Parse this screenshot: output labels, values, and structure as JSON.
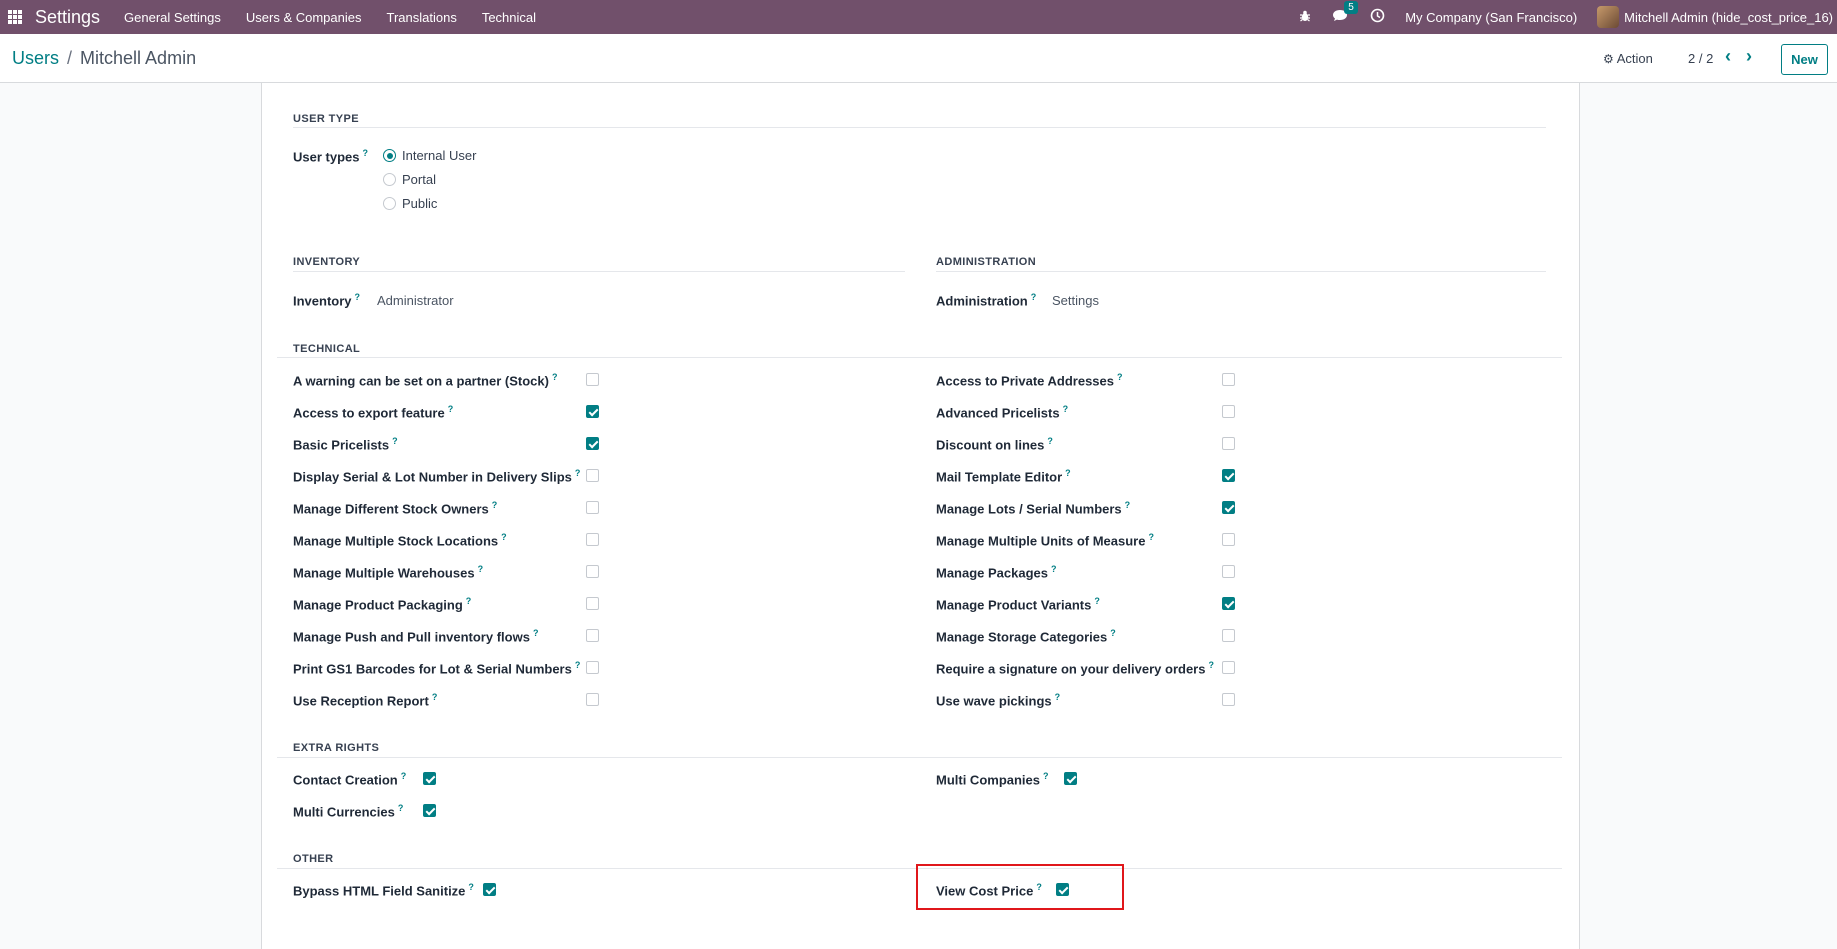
{
  "navbar": {
    "brand": "Settings",
    "menu": [
      "General Settings",
      "Users & Companies",
      "Translations",
      "Technical"
    ],
    "chat_count": "5",
    "company": "My Company (San Francisco)",
    "user": "Mitchell Admin (hide_cost_price_16)"
  },
  "control": {
    "breadcrumb_parent": "Users",
    "breadcrumb_sep": "/",
    "breadcrumb_current": "Mitchell Admin",
    "action": "Action",
    "pager": "2 / 2",
    "new": "New"
  },
  "user_type": {
    "title": "USER TYPE",
    "label": "User types",
    "options": [
      "Internal User",
      "Portal",
      "Public"
    ],
    "selected": "Internal User"
  },
  "inventory": {
    "title": "INVENTORY",
    "label": "Inventory",
    "value": "Administrator"
  },
  "administration": {
    "title": "ADMINISTRATION",
    "label": "Administration",
    "value": "Settings"
  },
  "technical": {
    "title": "TECHNICAL",
    "left": [
      {
        "label": "A warning can be set on a partner (Stock)",
        "checked": false
      },
      {
        "label": "Access to export feature",
        "checked": true
      },
      {
        "label": "Basic Pricelists",
        "checked": true
      },
      {
        "label": "Display Serial & Lot Number in Delivery Slips",
        "checked": false
      },
      {
        "label": "Manage Different Stock Owners",
        "checked": false
      },
      {
        "label": "Manage Multiple Stock Locations",
        "checked": false
      },
      {
        "label": "Manage Multiple Warehouses",
        "checked": false
      },
      {
        "label": "Manage Product Packaging",
        "checked": false
      },
      {
        "label": "Manage Push and Pull inventory flows",
        "checked": false
      },
      {
        "label": "Print GS1 Barcodes for Lot & Serial Numbers",
        "checked": false
      },
      {
        "label": "Use Reception Report",
        "checked": false
      }
    ],
    "right": [
      {
        "label": "Access to Private Addresses",
        "checked": false
      },
      {
        "label": "Advanced Pricelists",
        "checked": false
      },
      {
        "label": "Discount on lines",
        "checked": false
      },
      {
        "label": "Mail Template Editor",
        "checked": true
      },
      {
        "label": "Manage Lots / Serial Numbers",
        "checked": true
      },
      {
        "label": "Manage Multiple Units of Measure",
        "checked": false
      },
      {
        "label": "Manage Packages",
        "checked": false
      },
      {
        "label": "Manage Product Variants",
        "checked": true
      },
      {
        "label": "Manage Storage Categories",
        "checked": false
      },
      {
        "label": "Require a signature on your delivery orders",
        "checked": false
      },
      {
        "label": "Use wave pickings",
        "checked": false
      }
    ]
  },
  "extra_rights": {
    "title": "EXTRA RIGHTS",
    "contact_creation": {
      "label": "Contact Creation",
      "checked": true
    },
    "multi_currencies": {
      "label": "Multi Currencies",
      "checked": true
    },
    "multi_companies": {
      "label": "Multi Companies",
      "checked": true
    }
  },
  "other": {
    "title": "OTHER",
    "bypass_html": {
      "label": "Bypass HTML Field Sanitize",
      "checked": true
    },
    "view_cost_price": {
      "label": "View Cost Price",
      "checked": true
    }
  },
  "help_mark": "?"
}
